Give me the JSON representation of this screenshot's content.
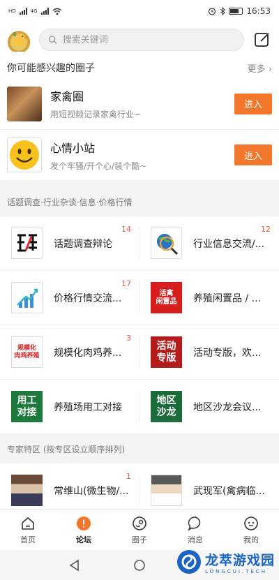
{
  "status_bar": {
    "left_labels": [
      "HD",
      "4G",
      "HD",
      "4G"
    ],
    "time": "16:53"
  },
  "header": {
    "search_placeholder": "搜索关键词"
  },
  "interest_section": {
    "title": "你可能感兴趣的圈子",
    "more_label": "更多",
    "circles": [
      {
        "name": "家禽圈",
        "desc": "用短视频记录家禽行业~",
        "button": "进入"
      },
      {
        "name": "心情小站",
        "desc": "发个牢骚/开个心/装个酷~",
        "button": "进入"
      }
    ]
  },
  "topic_section": {
    "title": "话题调查·行业杂谈·信息·价格行情",
    "forums": [
      {
        "title": "话题调查辩论",
        "badge": "14",
        "thumb_text": ""
      },
      {
        "title": "行业信息交流/...",
        "badge": "12",
        "thumb_text": ""
      },
      {
        "title": "价格行情交流...",
        "badge": "17",
        "thumb_text": ""
      },
      {
        "title": "养殖闲置品 / ...",
        "badge": "",
        "thumb_text": "活禽\n闲置品"
      },
      {
        "title": "规模化肉鸡养...",
        "badge": "3",
        "thumb_text": "规模化\n肉鸡养殖"
      },
      {
        "title": "活动专版，欢...",
        "badge": "",
        "thumb_text": "活动\n专版"
      },
      {
        "title": "养殖场用工对接",
        "badge": "",
        "thumb_text": "用工\n对接"
      },
      {
        "title": "地区沙龙会议...",
        "badge": "",
        "thumb_text": "地区\n沙龙"
      }
    ]
  },
  "expert_section": {
    "title": "专家特区 (按专区设立顺序排列)",
    "experts": [
      {
        "title": "常维山(微生物/...",
        "badge": "1"
      },
      {
        "title": "武现军(禽病临...",
        "badge": ""
      }
    ]
  },
  "tabbar": {
    "tabs": [
      {
        "label": "首页",
        "icon": "home-icon"
      },
      {
        "label": "论坛",
        "icon": "forum-icon"
      },
      {
        "label": "圈子",
        "icon": "circle-icon"
      },
      {
        "label": "消息",
        "icon": "message-icon"
      },
      {
        "label": "我的",
        "icon": "profile-icon"
      }
    ],
    "active_index": 1
  },
  "watermark": {
    "main": "龙萃游戏园",
    "sub": "LONGCUI.TECH"
  },
  "colors": {
    "accent": "#f2762b",
    "badge": "#e05a4a",
    "watermark": "#1b64c4"
  }
}
